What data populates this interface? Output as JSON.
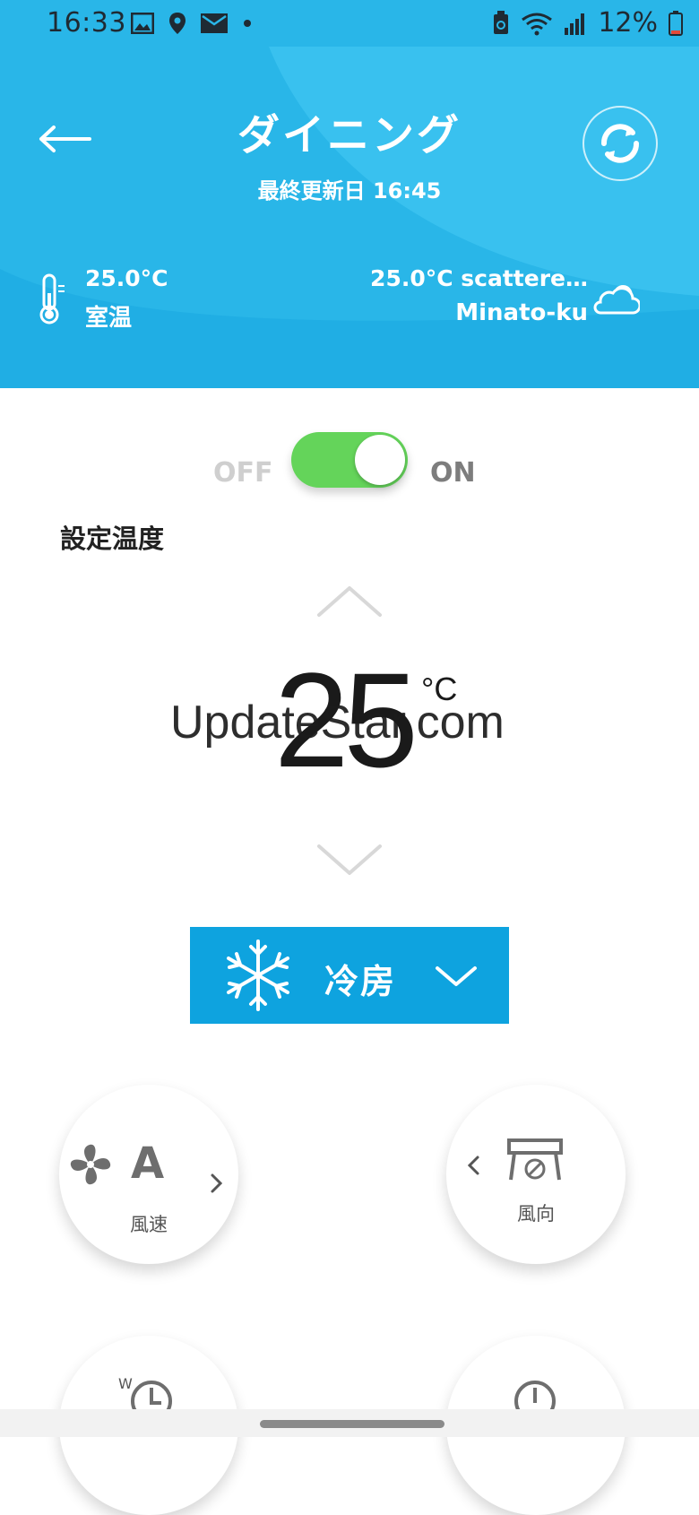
{
  "status_bar": {
    "time": "16:33",
    "battery": "12%"
  },
  "header": {
    "title": "ダイニング",
    "updated": "最終更新日 16:45",
    "room_temp_value": "25.0°C",
    "room_temp_label": "室温",
    "weather_text": "25.0°C scattere…",
    "weather_location": "Minato-ku"
  },
  "power": {
    "off_label": "OFF",
    "on_label": "ON",
    "state": "on"
  },
  "set_temp": {
    "label": "設定温度",
    "value": "25",
    "unit": "°C"
  },
  "watermark": "UpdateStar.com",
  "mode": {
    "label": "冷房"
  },
  "fan": {
    "value": "A",
    "label": "風速"
  },
  "direction": {
    "label": "風向"
  },
  "timer1": {
    "badge": "W"
  },
  "colors": {
    "header": "#29b6e8",
    "mode_button": "#0ea3df",
    "toggle_on": "#64d45a"
  }
}
